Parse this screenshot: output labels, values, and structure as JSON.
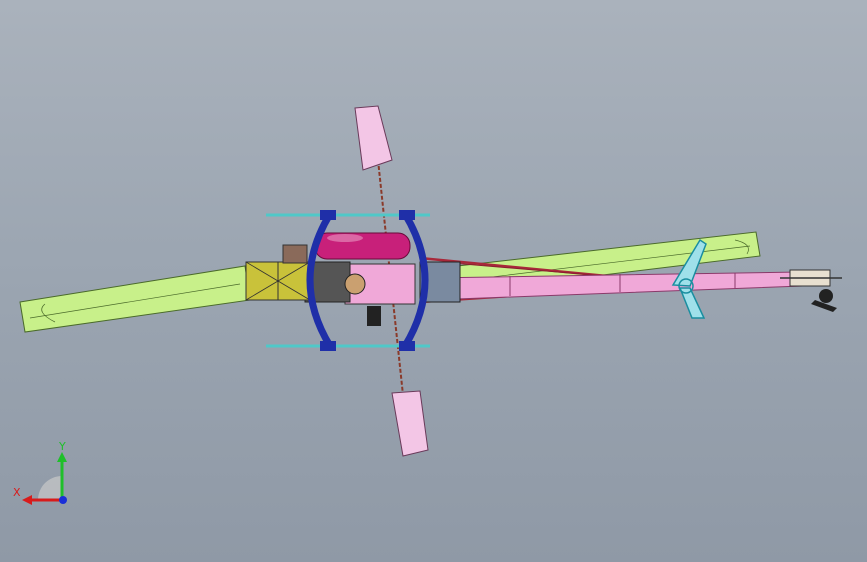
{
  "viewport": {
    "background_top": "#aab2bc",
    "background_bottom": "#8f99a6"
  },
  "triad": {
    "x_label": "X",
    "y_label": "Y",
    "x_color": "#d81b1b",
    "y_color": "#1fbf2a",
    "z_color": "#1a2fd8"
  },
  "colors": {
    "main_rotor": "#c8f08a",
    "rotor_outline": "#4a6a2a",
    "flybar_paddle": "#f3c6e6",
    "frame_blue": "#1f2fa8",
    "fuel_tank": "#c8207a",
    "tail_boom": "#f0a8d8",
    "boom_support": "#a8283a",
    "tail_fin": "#36c8d8",
    "battery_box": "#c9c23a",
    "skid_rod": "#4fc8c8"
  }
}
